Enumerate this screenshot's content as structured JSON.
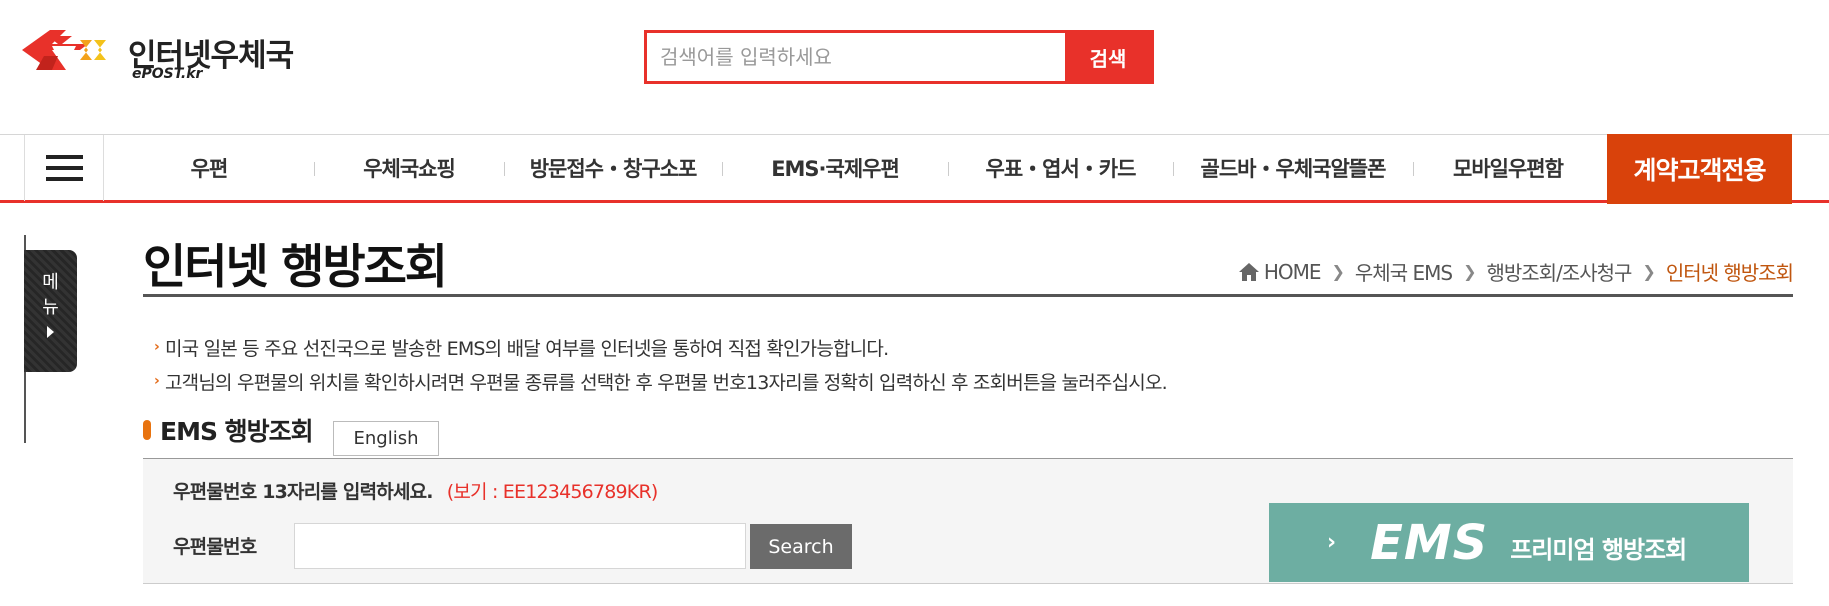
{
  "header": {
    "logo_title": "인터넷우체국",
    "logo_sub": "ePOST.kr",
    "search_placeholder": "검색어를 입력하세요",
    "search_button": "검색"
  },
  "gnb": {
    "items": [
      {
        "label": "우편"
      },
      {
        "label": "우체국쇼핑"
      },
      {
        "label": "방문접수・창구소포"
      },
      {
        "label": "EMS·국제우편"
      },
      {
        "label": "우표・엽서・카드"
      },
      {
        "label": "골드바・우체국알뜰폰"
      },
      {
        "label": "모바일우편함"
      }
    ],
    "special": "계약고객전용"
  },
  "side_tab": {
    "line1": "메",
    "line2": "뉴"
  },
  "page": {
    "title": "인터넷 행방조회",
    "breadcrumb": [
      "HOME",
      "우체국 EMS",
      "행방조회/조사청구",
      "인터넷 행방조회"
    ],
    "bullets": [
      "미국 일본 등 주요 선진국으로 발송한 EMS의 배달 여부를 인터넷을 통하여 직접 확인가능합니다.",
      "고객님의 우편물의 위치를 확인하시려면 우편물 종류를 선택한 후 우편물 번호13자리를 정확히 입력하신 후 조회버튼을 눌러주십시오."
    ]
  },
  "ems_section": {
    "title": "EMS 행방조회",
    "english_button": "English",
    "hint": "우편물번호 13자리를 입력하세요.",
    "example": "(보기 : EE123456789KR)",
    "field_label": "우편물번호",
    "field_value": "",
    "search_button": "Search",
    "premium": {
      "brand": "EMS",
      "label": "프리미엄 행방조회"
    }
  }
}
